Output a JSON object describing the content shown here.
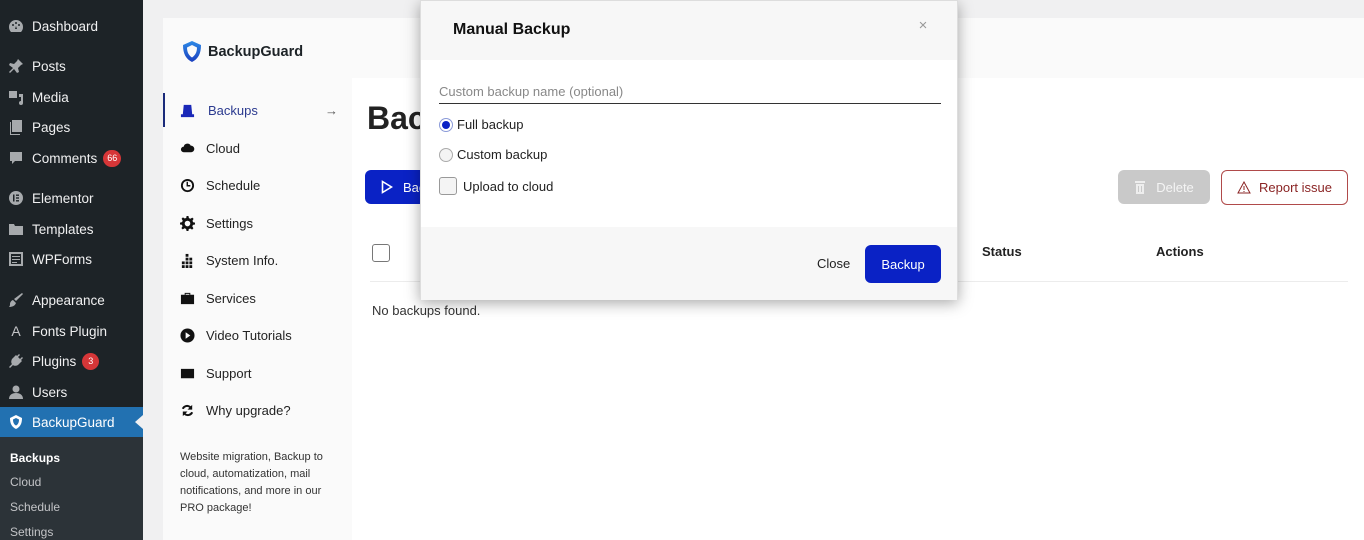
{
  "wp_menu": {
    "items": [
      {
        "label": "Dashboard",
        "icon": "dashboard-icon"
      },
      {
        "label": "Posts",
        "icon": "pin-icon"
      },
      {
        "label": "Media",
        "icon": "media-icon"
      },
      {
        "label": "Pages",
        "icon": "pages-icon"
      },
      {
        "label": "Comments",
        "icon": "comment-icon",
        "badge": "66"
      },
      {
        "label": "Elementor",
        "icon": "elementor-icon"
      },
      {
        "label": "Templates",
        "icon": "folder-icon"
      },
      {
        "label": "WPForms",
        "icon": "form-icon"
      },
      {
        "label": "Appearance",
        "icon": "brush-icon"
      },
      {
        "label": "Fonts Plugin",
        "icon": "font-icon"
      },
      {
        "label": "Plugins",
        "icon": "plug-icon",
        "badge": "3"
      },
      {
        "label": "Users",
        "icon": "user-icon"
      },
      {
        "label": "BackupGuard",
        "icon": "shield-icon",
        "active": true
      }
    ],
    "submenu": [
      "Backups",
      "Cloud",
      "Schedule",
      "Settings"
    ],
    "submenu_current": "Backups"
  },
  "plugin": {
    "logo_text": "BackupGuard",
    "nav": [
      {
        "label": "Backups",
        "icon": "backup-icon",
        "active": true,
        "arrow": "→"
      },
      {
        "label": "Cloud",
        "icon": "cloud-icon"
      },
      {
        "label": "Schedule",
        "icon": "clock-icon"
      },
      {
        "label": "Settings",
        "icon": "gear-icon"
      },
      {
        "label": "System Info.",
        "icon": "system-info-icon"
      },
      {
        "label": "Services",
        "icon": "briefcase-icon"
      },
      {
        "label": "Video Tutorials",
        "icon": "play-icon"
      },
      {
        "label": "Support",
        "icon": "envelope-icon"
      },
      {
        "label": "Why upgrade?",
        "icon": "refresh-icon"
      }
    ],
    "promo": "Website migration, Backup to cloud, automatization, mail notifications, and more in our PRO package!"
  },
  "main": {
    "title": "Backups",
    "backup_button": "Backup",
    "delete_button": "Delete",
    "report_button": "Report issue",
    "table_headers": {
      "status": "Status",
      "actions": "Actions"
    },
    "empty_message": "No backups found."
  },
  "modal": {
    "title": "Manual Backup",
    "close_icon": "×",
    "name_placeholder": "Custom backup name (optional)",
    "name_value": "",
    "options": [
      {
        "label": "Full backup",
        "type": "radio",
        "checked": true
      },
      {
        "label": "Custom backup",
        "type": "radio",
        "checked": false
      },
      {
        "label": "Upload to cloud",
        "type": "checkbox",
        "checked": false
      }
    ],
    "close_button": "Close",
    "backup_button": "Backup"
  },
  "colors": {
    "wp_sidebar": "#1d2327",
    "wp_active": "#2271b1",
    "primary": "#0a22c5",
    "report": "#b04a4a",
    "badge": "#d63638"
  }
}
